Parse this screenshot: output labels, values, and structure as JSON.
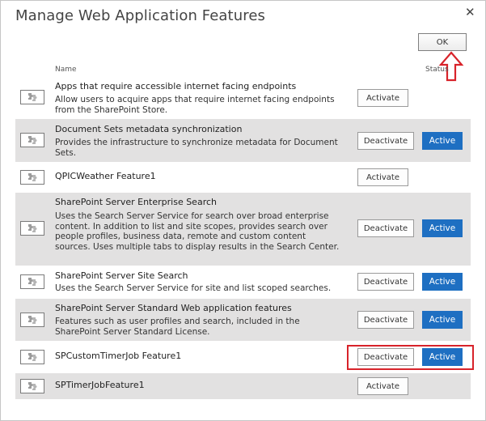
{
  "dialog": {
    "title": "Manage Web Application Features",
    "close_glyph": "✕",
    "ok_label": "OK"
  },
  "headers": {
    "name": "Name",
    "status": "Status"
  },
  "features": [
    {
      "name": "Apps that require accessible internet facing endpoints",
      "description": "Allow users to acquire apps that require internet facing endpoints from the SharePoint Store.",
      "button": "Activate",
      "status": "",
      "icon": "feature-puzzle-icon"
    },
    {
      "name": "Document Sets metadata synchronization",
      "description": "Provides the infrastructure to synchronize metadata for Document Sets.",
      "button": "Deactivate",
      "status": "Active",
      "icon": "feature-puzzle-icon"
    },
    {
      "name": "QPICWeather Feature1",
      "description": "",
      "button": "Activate",
      "status": "",
      "icon": "feature-puzzle-icon"
    },
    {
      "name": "SharePoint Server Enterprise Search",
      "description": "Uses the Search Server Service for search over broad enterprise content. In addition to list and site scopes, provides search over people profiles, business data, remote and custom content sources. Uses multiple tabs to display results in the Search Center.",
      "button": "Deactivate",
      "status": "Active",
      "icon": "feature-puzzle-icon"
    },
    {
      "name": "SharePoint Server Site Search",
      "description": "Uses the Search Server Service for site and list scoped searches.",
      "button": "Deactivate",
      "status": "Active",
      "icon": "feature-puzzle-icon"
    },
    {
      "name": "SharePoint Server Standard Web application features",
      "description": "Features such as user profiles and search, included in the SharePoint Server Standard License.",
      "button": "Deactivate",
      "status": "Active",
      "icon": "feature-puzzle-icon"
    },
    {
      "name": "SPCustomTimerJob Feature1",
      "description": "",
      "button": "Deactivate",
      "status": "Active",
      "icon": "feature-puzzle-icon"
    },
    {
      "name": "SPTimerJobFeature1",
      "description": "",
      "button": "Activate",
      "status": "",
      "icon": "feature-puzzle-icon"
    }
  ],
  "colors": {
    "active_status_bg": "#1e6fc2",
    "row_shade": "#e2e1e1",
    "highlight_red": "#d8232a"
  }
}
